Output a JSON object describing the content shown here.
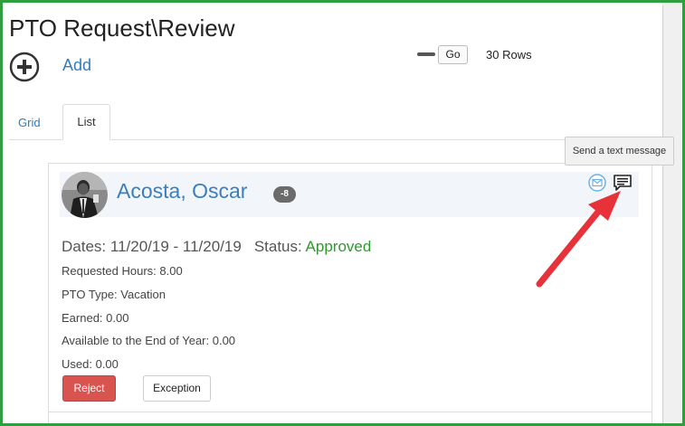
{
  "page": {
    "title": "PTO Request\\Review",
    "add_label": "Add",
    "go_label": "Go",
    "rows_label": "30 Rows"
  },
  "tabs": [
    {
      "label": "Grid",
      "active": false
    },
    {
      "label": "List",
      "active": true
    }
  ],
  "tooltip": {
    "text": "Send a text message"
  },
  "request": {
    "employee_name": "Acosta, Oscar",
    "badge": "-8",
    "dates_label": "Dates:",
    "dates_value": "11/20/19 - 11/20/19",
    "status_label": "Status:",
    "status_value": "Approved",
    "fields": [
      {
        "label": "Requested Hours:",
        "value": "8.00"
      },
      {
        "label": "PTO Type:",
        "value": "Vacation"
      },
      {
        "label": "Earned:",
        "value": "0.00"
      },
      {
        "label": "Available to the End of Year:",
        "value": "0.00"
      },
      {
        "label": "Used:",
        "value": "0.00"
      }
    ],
    "reject_label": "Reject",
    "exception_label": "Exception"
  },
  "icons": {
    "add": "plus-circle-icon",
    "email": "email-icon",
    "sms": "text-message-icon"
  },
  "colors": {
    "frame": "#2e9e3e",
    "link": "#2f7bbf",
    "approved": "#2d9a2d",
    "reject": "#d9534f",
    "arrow": "#e8323a"
  }
}
